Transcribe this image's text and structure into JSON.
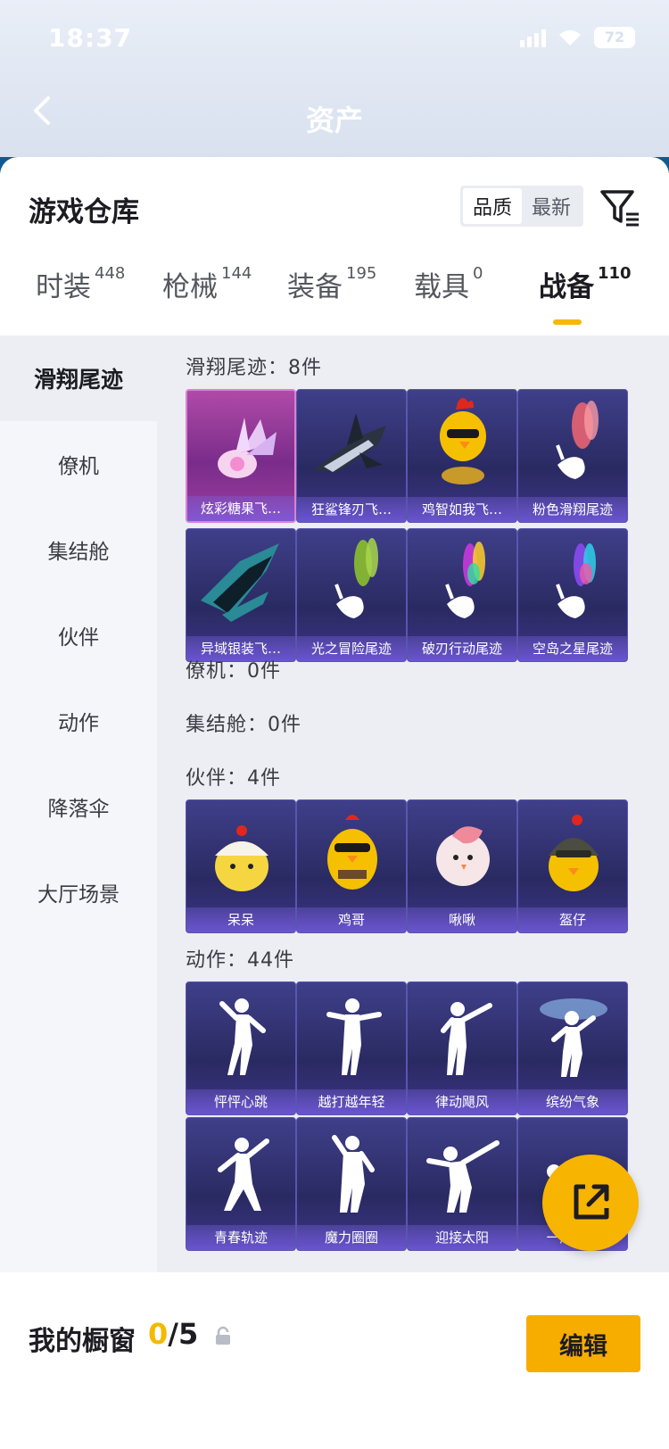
{
  "status": {
    "time": "18:37",
    "battery": "72"
  },
  "header": {
    "title": "资产"
  },
  "warehouse": {
    "title": "游戏仓库",
    "sort_options": [
      "品质",
      "最新"
    ],
    "active_sort": "品质"
  },
  "categories": [
    {
      "label": "时装",
      "count": "448"
    },
    {
      "label": "枪械",
      "count": "144"
    },
    {
      "label": "装备",
      "count": "195"
    },
    {
      "label": "载具",
      "count": "0"
    },
    {
      "label": "战备",
      "count": "110",
      "active": true
    }
  ],
  "sidebar": {
    "items": [
      "滑翔尾迹",
      "僚机",
      "集结舱",
      "伙伴",
      "动作",
      "降落伞",
      "大厅场景"
    ],
    "active_index": 0
  },
  "sections": {
    "glide": {
      "title": "滑翔尾迹：8件",
      "items": [
        "炫彩糖果飞…",
        "狂鲨锋刃飞…",
        "鸡智如我飞…",
        "粉色滑翔尾迹",
        "异域银装飞…",
        "光之冒险尾迹",
        "破刃行动尾迹",
        "空岛之星尾迹"
      ]
    },
    "wingman": {
      "title": "僚机：0件"
    },
    "pod": {
      "title": "集结舱：0件"
    },
    "partner": {
      "title": "伙伴：4件",
      "items": [
        "呆呆",
        "鸡哥",
        "啾啾",
        "盔仔"
      ]
    },
    "emote": {
      "title": "动作：44件",
      "items": [
        "怦怦心跳",
        "越打越年轻",
        "律动飓风",
        "缤纷气象",
        "青春轨迹",
        "魔力圈圈",
        "迎接太阳",
        "一起666"
      ]
    }
  },
  "showcase": {
    "label": "我的橱窗",
    "current": "0",
    "total": "/5"
  },
  "edit_label": "编辑",
  "colors": {
    "accent": "#f7b400",
    "tile_bg": "#2f2f6e",
    "tile_rare": "#9a3e9f"
  }
}
